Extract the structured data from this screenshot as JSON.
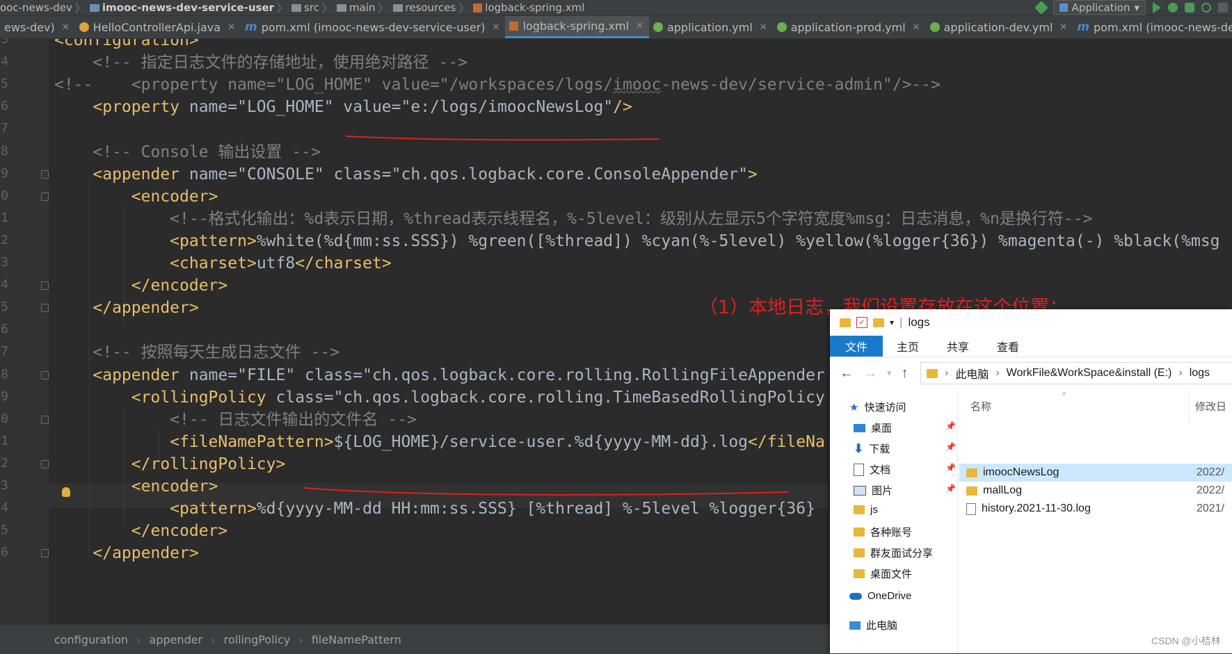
{
  "breadcrumbs": [
    "ooc-news-dev",
    "imooc-news-dev-service-user",
    "src",
    "main",
    "resources",
    "logback-spring.xml"
  ],
  "run_config": "Application",
  "tabs": [
    {
      "label": "ews-dev)",
      "icon": "module-icon"
    },
    {
      "label": "HelloControllerApi.java",
      "icon": "java-class-icon"
    },
    {
      "label": "pom.xml (imooc-news-dev-service-user)",
      "icon": "maven-icon"
    },
    {
      "label": "logback-spring.xml",
      "icon": "xml-file-icon",
      "active": true
    },
    {
      "label": "application.yml",
      "icon": "yaml-icon"
    },
    {
      "label": "application-prod.yml",
      "icon": "yaml-icon"
    },
    {
      "label": "application-dev.yml",
      "icon": "yaml-icon"
    },
    {
      "label": "pom.xml (imooc-news-dev-service-a",
      "icon": "maven-icon"
    }
  ],
  "editor": {
    "line_numbers": [
      "3",
      "4",
      "5",
      "6",
      "7",
      "8",
      "9",
      "0",
      "1",
      "2",
      "3",
      "4",
      "5",
      "6",
      "7",
      "8",
      "9",
      "0",
      "1",
      "2",
      "3",
      "4",
      "5",
      "6"
    ],
    "lines": [
      "<configuration>",
      "    <!-- 指定日志文件的存储地址，使用绝对路径 -->",
      "<!--    <property name=\"LOG_HOME\" value=\"/workspaces/logs/imooc-news-dev/service-admin\"/>-->",
      "    <property name=\"LOG_HOME\" value=\"e:/logs/imoocNewsLog\"/>",
      "",
      "    <!-- Console 输出设置 -->",
      "    <appender name=\"CONSOLE\" class=\"ch.qos.logback.core.ConsoleAppender\">",
      "        <encoder>",
      "            <!--格式化输出：%d表示日期，%thread表示线程名，%-5level：级别从左显示5个字符宽度%msg：日志消息，%n是换行符-->",
      "            <pattern>%white(%d{mm:ss.SSS}) %green([%thread]) %cyan(%-5level) %yellow(%logger{36}) %magenta(-) %black(%msg",
      "            <charset>utf8</charset>",
      "        </encoder>",
      "    </appender>",
      "",
      "    <!-- 按照每天生成日志文件 -->",
      "    <appender name=\"FILE\" class=\"ch.qos.logback.core.rolling.RollingFileAppender",
      "        <rollingPolicy class=\"ch.qos.logback.core.rolling.TimeBasedRollingPolicy",
      "            <!-- 日志文件输出的文件名 -->",
      "            <fileNamePattern>${LOG_HOME}/service-user.%d{yyyy-MM-dd}.log</fileNa",
      "        </rollingPolicy>",
      "        <encoder>",
      "            <pattern>%d{yyyy-MM-dd HH:mm:ss.SSS} [%thread] %-5level %logger{36}",
      "        </encoder>",
      "    </appender>"
    ]
  },
  "annotation": "（1）本地日志，我们设置存放在这个位置；",
  "status_breadcrumbs": [
    "configuration",
    "appender",
    "rollingPolicy",
    "fileNamePattern"
  ],
  "explorer": {
    "title": "logs",
    "ribbon_tabs": [
      "文件",
      "主页",
      "共享",
      "查看"
    ],
    "address_path": [
      "此电脑",
      "WorkFile&WorkSpace&install (E:)",
      "logs"
    ],
    "column_name": "名称",
    "column_modified": "修改日",
    "nav_items": [
      {
        "label": "快速访问",
        "icon": "star-icon"
      },
      {
        "label": "桌面",
        "icon": "desktop-icon",
        "pinned": true
      },
      {
        "label": "下载",
        "icon": "download-icon",
        "pinned": true
      },
      {
        "label": "文档",
        "icon": "document-icon",
        "pinned": true
      },
      {
        "label": "图片",
        "icon": "picture-icon",
        "pinned": true
      },
      {
        "label": "js",
        "icon": "folder-icon"
      },
      {
        "label": "各种账号",
        "icon": "folder-icon"
      },
      {
        "label": "群友面试分享",
        "icon": "folder-icon"
      },
      {
        "label": "桌面文件",
        "icon": "folder-icon"
      },
      {
        "label": "OneDrive",
        "icon": "cloud-icon"
      },
      {
        "label": "此电脑",
        "icon": "computer-icon"
      }
    ],
    "files": [
      {
        "name": "imoocNewsLog",
        "modified": "2022/",
        "type": "folder",
        "selected": true
      },
      {
        "name": "mallLog",
        "modified": "2022/",
        "type": "folder"
      },
      {
        "name": "history.2021-11-30.log",
        "modified": "2021/",
        "type": "file"
      }
    ]
  },
  "watermark": "CSDN @小桔林",
  "colors": {
    "annotation": "#e02020",
    "tag": "#e8bf6a",
    "value": "#6a8759",
    "comment": "#808080",
    "accent": "#4a88c7"
  }
}
